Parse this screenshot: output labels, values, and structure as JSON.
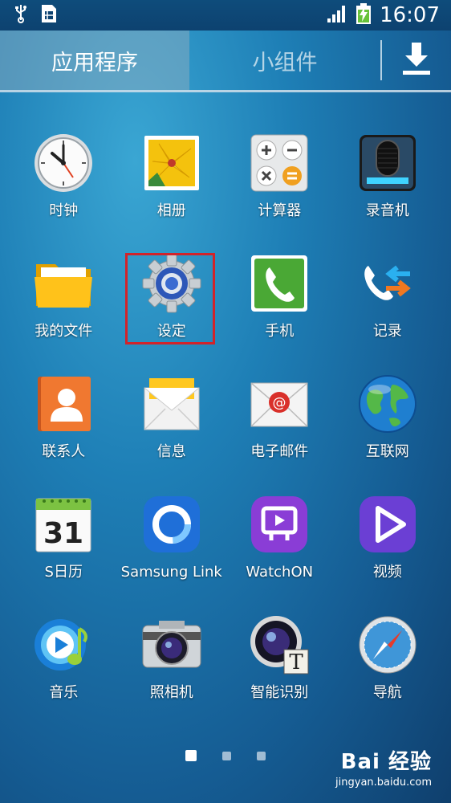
{
  "status_bar": {
    "time": "16:07",
    "icons": [
      "usb-icon",
      "sim-card-icon",
      "signal-icon",
      "battery-charging-icon"
    ]
  },
  "tabs": {
    "apps": "应用程序",
    "widgets": "小组件",
    "download_icon": "download-icon"
  },
  "apps": [
    {
      "label": "时钟",
      "icon": "clock-icon"
    },
    {
      "label": "相册",
      "icon": "gallery-icon"
    },
    {
      "label": "计算器",
      "icon": "calculator-icon"
    },
    {
      "label": "录音机",
      "icon": "voice-recorder-icon"
    },
    {
      "label": "我的文件",
      "icon": "folder-icon"
    },
    {
      "label": "设定",
      "icon": "settings-gear-icon"
    },
    {
      "label": "手机",
      "icon": "phone-icon"
    },
    {
      "label": "记录",
      "icon": "call-log-icon"
    },
    {
      "label": "联系人",
      "icon": "contacts-icon"
    },
    {
      "label": "信息",
      "icon": "messages-icon"
    },
    {
      "label": "电子邮件",
      "icon": "email-icon"
    },
    {
      "label": "互联网",
      "icon": "globe-icon"
    },
    {
      "label": "S日历",
      "icon": "calendar-icon",
      "calendar_day": "31"
    },
    {
      "label": "Samsung Link",
      "icon": "samsung-link-icon"
    },
    {
      "label": "WatchON",
      "icon": "watchon-icon"
    },
    {
      "label": "视频",
      "icon": "video-icon"
    },
    {
      "label": "音乐",
      "icon": "music-icon"
    },
    {
      "label": "照相机",
      "icon": "camera-icon"
    },
    {
      "label": "智能识别",
      "icon": "optical-reader-icon",
      "badge_letter": "T"
    },
    {
      "label": "导航",
      "icon": "compass-icon"
    }
  ],
  "pagination": {
    "pages": 3,
    "active": 1
  },
  "watermark": {
    "brand": "Bai 经验",
    "url": "jingyan.baidu.com"
  },
  "colors": {
    "highlight": "#d2232a",
    "bar": "#0d4270"
  }
}
